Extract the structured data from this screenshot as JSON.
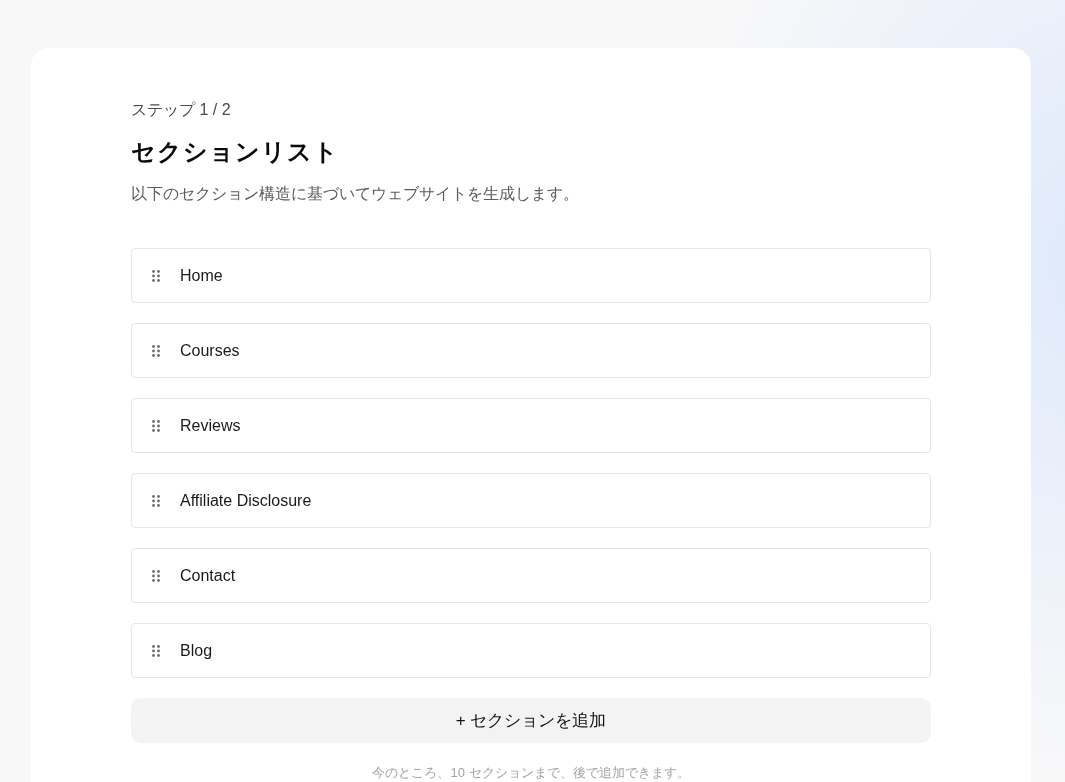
{
  "step_label": "ステップ 1 / 2",
  "title": "セクションリスト",
  "description": "以下のセクション構造に基づいてウェブサイトを生成します。",
  "sections": [
    {
      "label": "Home"
    },
    {
      "label": "Courses"
    },
    {
      "label": "Reviews"
    },
    {
      "label": "Affiliate Disclosure"
    },
    {
      "label": "Contact"
    },
    {
      "label": "Blog"
    }
  ],
  "add_button": {
    "label": "+ セクションを追加"
  },
  "footnote": "今のところ、10 セクションまで、後で追加できます。"
}
